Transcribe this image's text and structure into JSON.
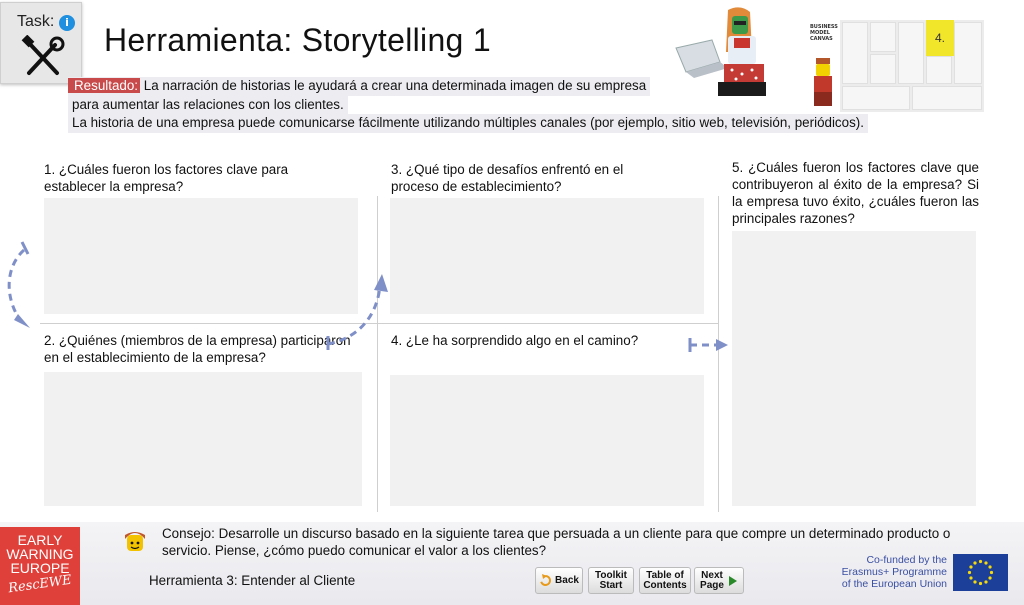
{
  "task": {
    "label": "Task:",
    "info_glyph": "i"
  },
  "title": "Herramienta: Storytelling 1",
  "result": {
    "tag": "Resultado:",
    "line1": " La narración de historias le ayudará a crear una determinada imagen de su empresa",
    "line2": "para aumentar las relaciones con los clientes.",
    "line3": "La historia de una empresa puede comunicarse fácilmente utilizando múltiples canales (por ejemplo, sitio web, televisión, periódicos)."
  },
  "canvas_thumb": {
    "title": "BUSINESS MODEL CANVAS",
    "highlight": "4."
  },
  "questions": {
    "q1": "1. ¿Cuáles fueron los factores clave para establecer la empresa?",
    "q2": "2. ¿Quiénes (miembros de la empresa) participaron en el establecimiento de la empresa?",
    "q3": "3. ¿Qué tipo de desafíos enfrentó en el proceso de establecimiento?",
    "q4": "4. ¿Le ha sorprendido algo en el camino?",
    "q5": "5. ¿Cuáles fueron los factores clave que contribuyeron al éxito de la empresa? Si la empresa tuvo éxito, ¿cuáles fueron las principales razones?"
  },
  "footer": {
    "logo": {
      "line1": "EARLY",
      "line2": "WARNING",
      "line3": "EUROPE",
      "script": "RescEWE"
    },
    "tip": "Consejo: Desarrolle un discurso basado en la siguiente tarea que persuada a un cliente para que compre un determinado producto o servicio. Piense, ¿cómo puedo comunicar el valor a los clientes?",
    "tool_name": "Herramienta 3: Entender al Cliente",
    "nav": {
      "back": "Back",
      "toolkit_1": "Toolkit",
      "toolkit_2": "Start",
      "toc_1": "Table of",
      "toc_2": "Contents",
      "next_1": "Next",
      "next_2": "Page"
    },
    "cofunded": {
      "line1": "Co-funded by the",
      "line2": "Erasmus+ Programme",
      "line3": "of the European Union"
    }
  },
  "colors": {
    "result_tag": "#c94a4a",
    "arrow": "#7f8fc8",
    "logo_red": "#e0403a",
    "eu_blue": "#1c3f99",
    "highlight_yellow": "#f2e62a"
  }
}
